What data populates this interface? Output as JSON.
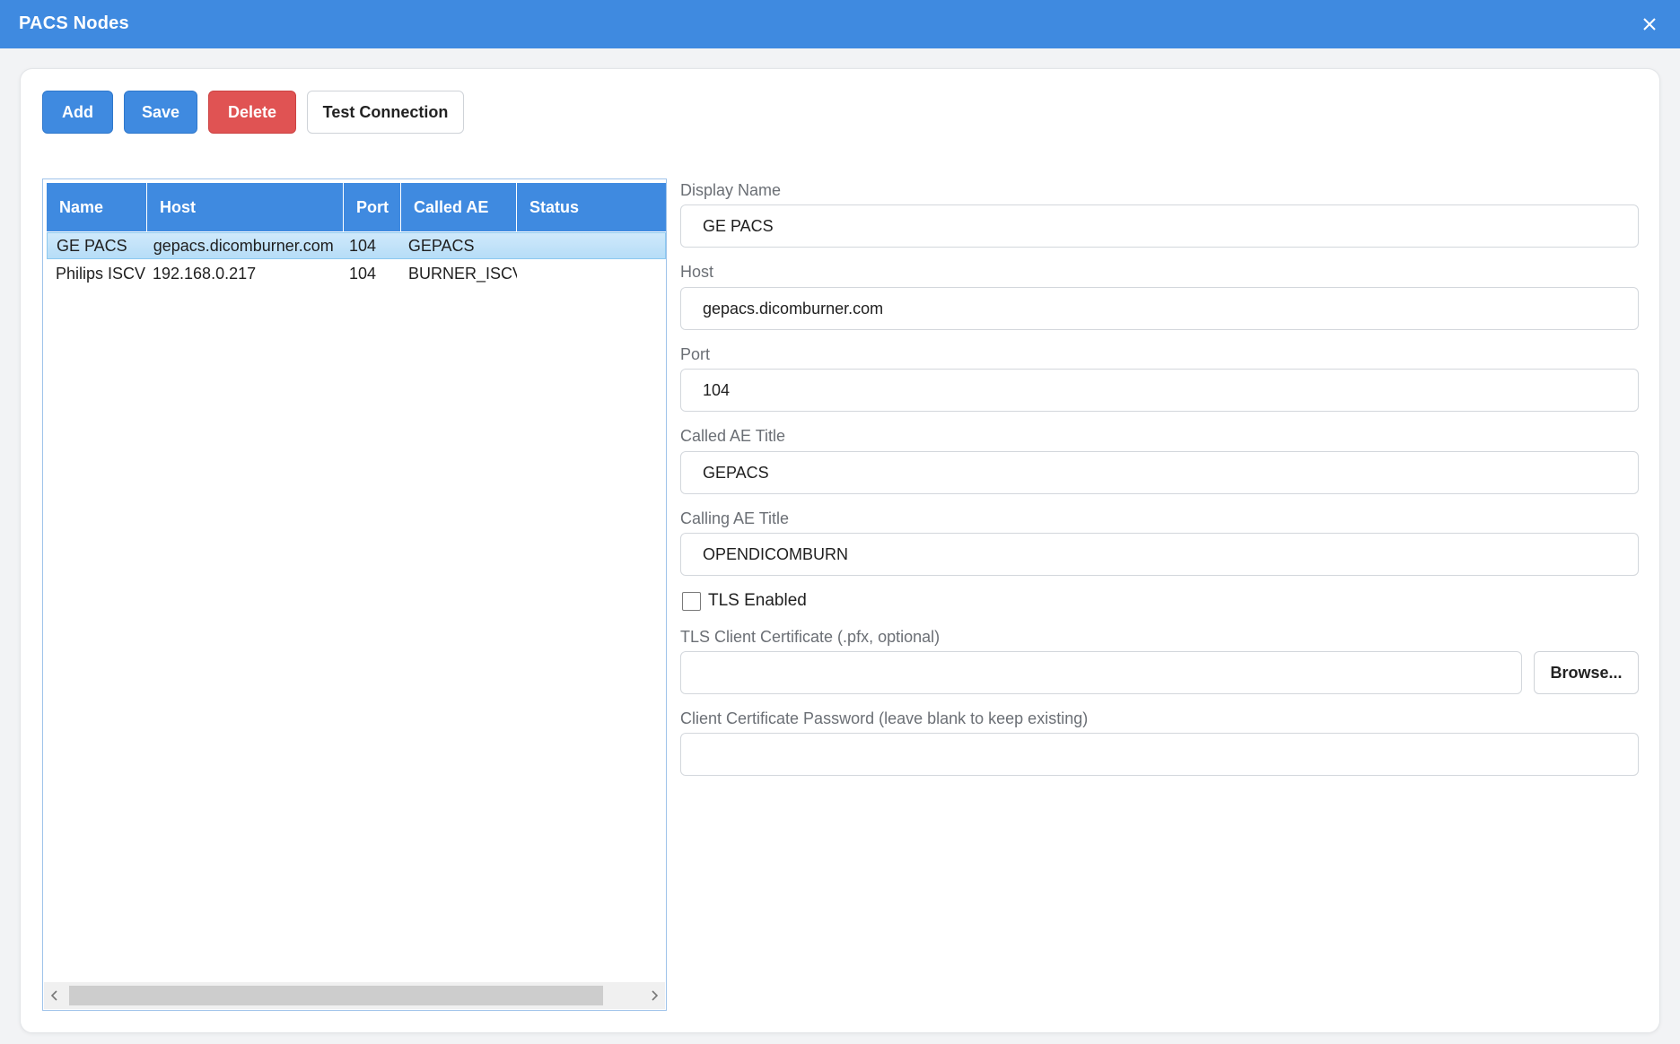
{
  "window": {
    "title": "PACS Nodes"
  },
  "toolbar": {
    "add_label": "Add",
    "save_label": "Save",
    "delete_label": "Delete",
    "test_label": "Test Connection"
  },
  "grid": {
    "columns": [
      "Name",
      "Host",
      "Port",
      "Called AE",
      "Status"
    ],
    "rows": [
      {
        "name": "GE PACS",
        "host": "gepacs.dicomburner.com",
        "port": "104",
        "called_ae": "GEPACS",
        "status": "",
        "selected": true
      },
      {
        "name": "Philips ISCV",
        "host": "192.168.0.217",
        "port": "104",
        "called_ae": "BURNER_ISCV",
        "status": "",
        "selected": false
      }
    ]
  },
  "form": {
    "display_name_label": "Display Name",
    "display_name_value": "GE PACS",
    "host_label": "Host",
    "host_value": "gepacs.dicomburner.com",
    "port_label": "Port",
    "port_value": "104",
    "called_ae_label": "Called AE Title",
    "called_ae_value": "GEPACS",
    "calling_ae_label": "Calling AE Title",
    "calling_ae_value": "OPENDICOMBURN",
    "tls_enabled_label": "TLS Enabled",
    "tls_enabled": false,
    "tls_cert_label": "TLS Client Certificate (.pfx, optional)",
    "tls_cert_value": "",
    "browse_label": "Browse...",
    "cert_password_label": "Client Certificate Password (leave blank to keep existing)",
    "cert_password_value": ""
  },
  "icons": {
    "close": "close-icon",
    "scroll_left": "chevron-left-icon",
    "scroll_right": "chevron-right-icon"
  },
  "colors": {
    "accent": "#3f8ae0",
    "danger": "#e05353",
    "selected_row": "#c4e3f9"
  }
}
